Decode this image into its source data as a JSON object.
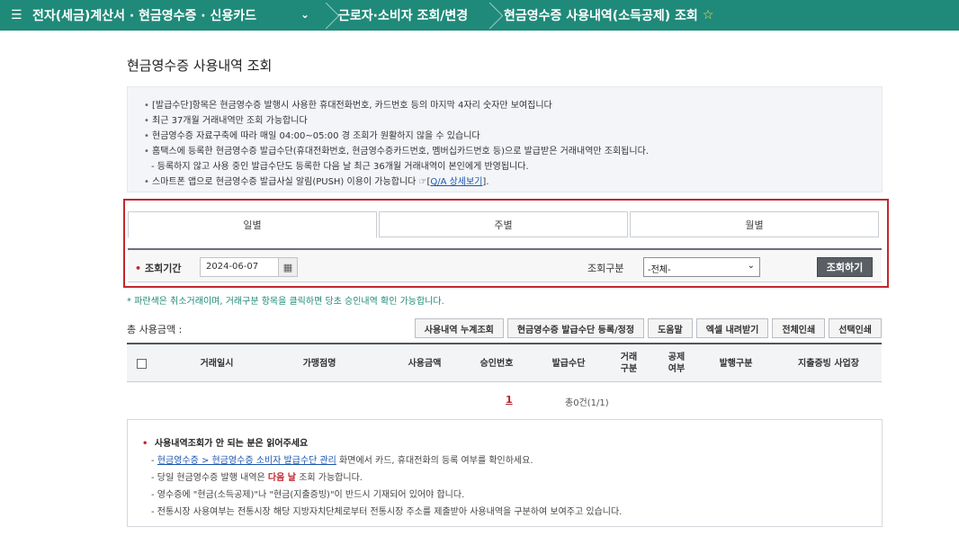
{
  "nav": {
    "menu_icon": "☰",
    "seg1": "전자(세금)계산서 · 현금영수증 · 신용카드",
    "seg1_chevron": "⌄",
    "seg2": "근로자·소비자 조회/변경",
    "seg3": "현금영수증 사용내역(소득공제) 조회",
    "star_icon": "☆"
  },
  "page_title": "현금영수증 사용내역 조회",
  "info": {
    "line1": "[발급수단]항목은 현금영수증 발행시 사용한 휴대전화번호, 카드번호 등의 마지막 4자리 숫자만 보여집니다",
    "line2": "최근 37개월 거래내역만 조회 가능합니다",
    "line3": "현금영수증 자료구축에 따라 매일 04:00~05:00 경 조회가 원활하지 않을 수 있습니다",
    "line4": "홈택스에 등록한 현금영수증 발급수단(휴대전화번호, 현금영수증카드번호, 멤버십카드번호 등)으로 발급받은 거래내역만 조회됩니다.",
    "line5": "- 등록하지 않고 사용 중인 발급수단도 등록한 다음 날 최근 36개월 거래내역이 본인에게 반영됩니다.",
    "line6": "스마트폰 앱으로 현금영수증 발급사실 알림(PUSH) 이용이 가능합니다 ☞",
    "line6_link": "Q/A 상세보기",
    "line6_suffix": "]"
  },
  "tabs": [
    {
      "label": "일별"
    },
    {
      "label": "주별"
    },
    {
      "label": "월별"
    }
  ],
  "search": {
    "required_mark": "•",
    "period_label": "조회기간",
    "date_value": "2024-06-07",
    "calendar_icon": "▦",
    "type_label": "조회구분",
    "type_value": "-전체-",
    "type_arrow": "⌄",
    "search_button": "조회하기"
  },
  "note_blue": "* 파란색은 취소거래이며, 거래구분 항목을 클릭하면 당초 승인내역 확인 가능합니다.",
  "total_label": "총 사용금액 :",
  "actions": [
    "사용내역 누계조회",
    "현금영수증 발급수단 등록/정정",
    "도움말",
    "엑셀 내려받기",
    "전체인쇄",
    "선택인쇄"
  ],
  "table": {
    "headers": [
      "거래일시",
      "가맹점명",
      "사용금액",
      "승인번호",
      "발급수단",
      "거래\n구분",
      "공제\n여부",
      "발행구분",
      "지출증빙 사업장"
    ]
  },
  "pager": {
    "page": "1",
    "count": "총0건(1/1)"
  },
  "help": {
    "title": "사용내역조회가 안 되는 분은 읽어주세요",
    "line1_link": "현금영수증 > 현금영수증 소비자 발급수단 관리",
    "line1_rest": " 화면에서 카드, 휴대전화의 등록 여부를 확인하세요.",
    "line2_a": "당일 현금영수증 발행 내역은 ",
    "line2_red": "다음 날",
    "line2_b": " 조회 가능합니다.",
    "line3": "영수증에 \"현금(소득공제)\"나 \"현금(지출증빙)\"이 반드시 기재되어 있어야 합니다.",
    "line4": "전통시장 사용여부는 전통시장 해당 지방자치단체로부터 전통시장 주소를 제출받아 사용내역을 구분하여 보여주고 있습니다."
  }
}
